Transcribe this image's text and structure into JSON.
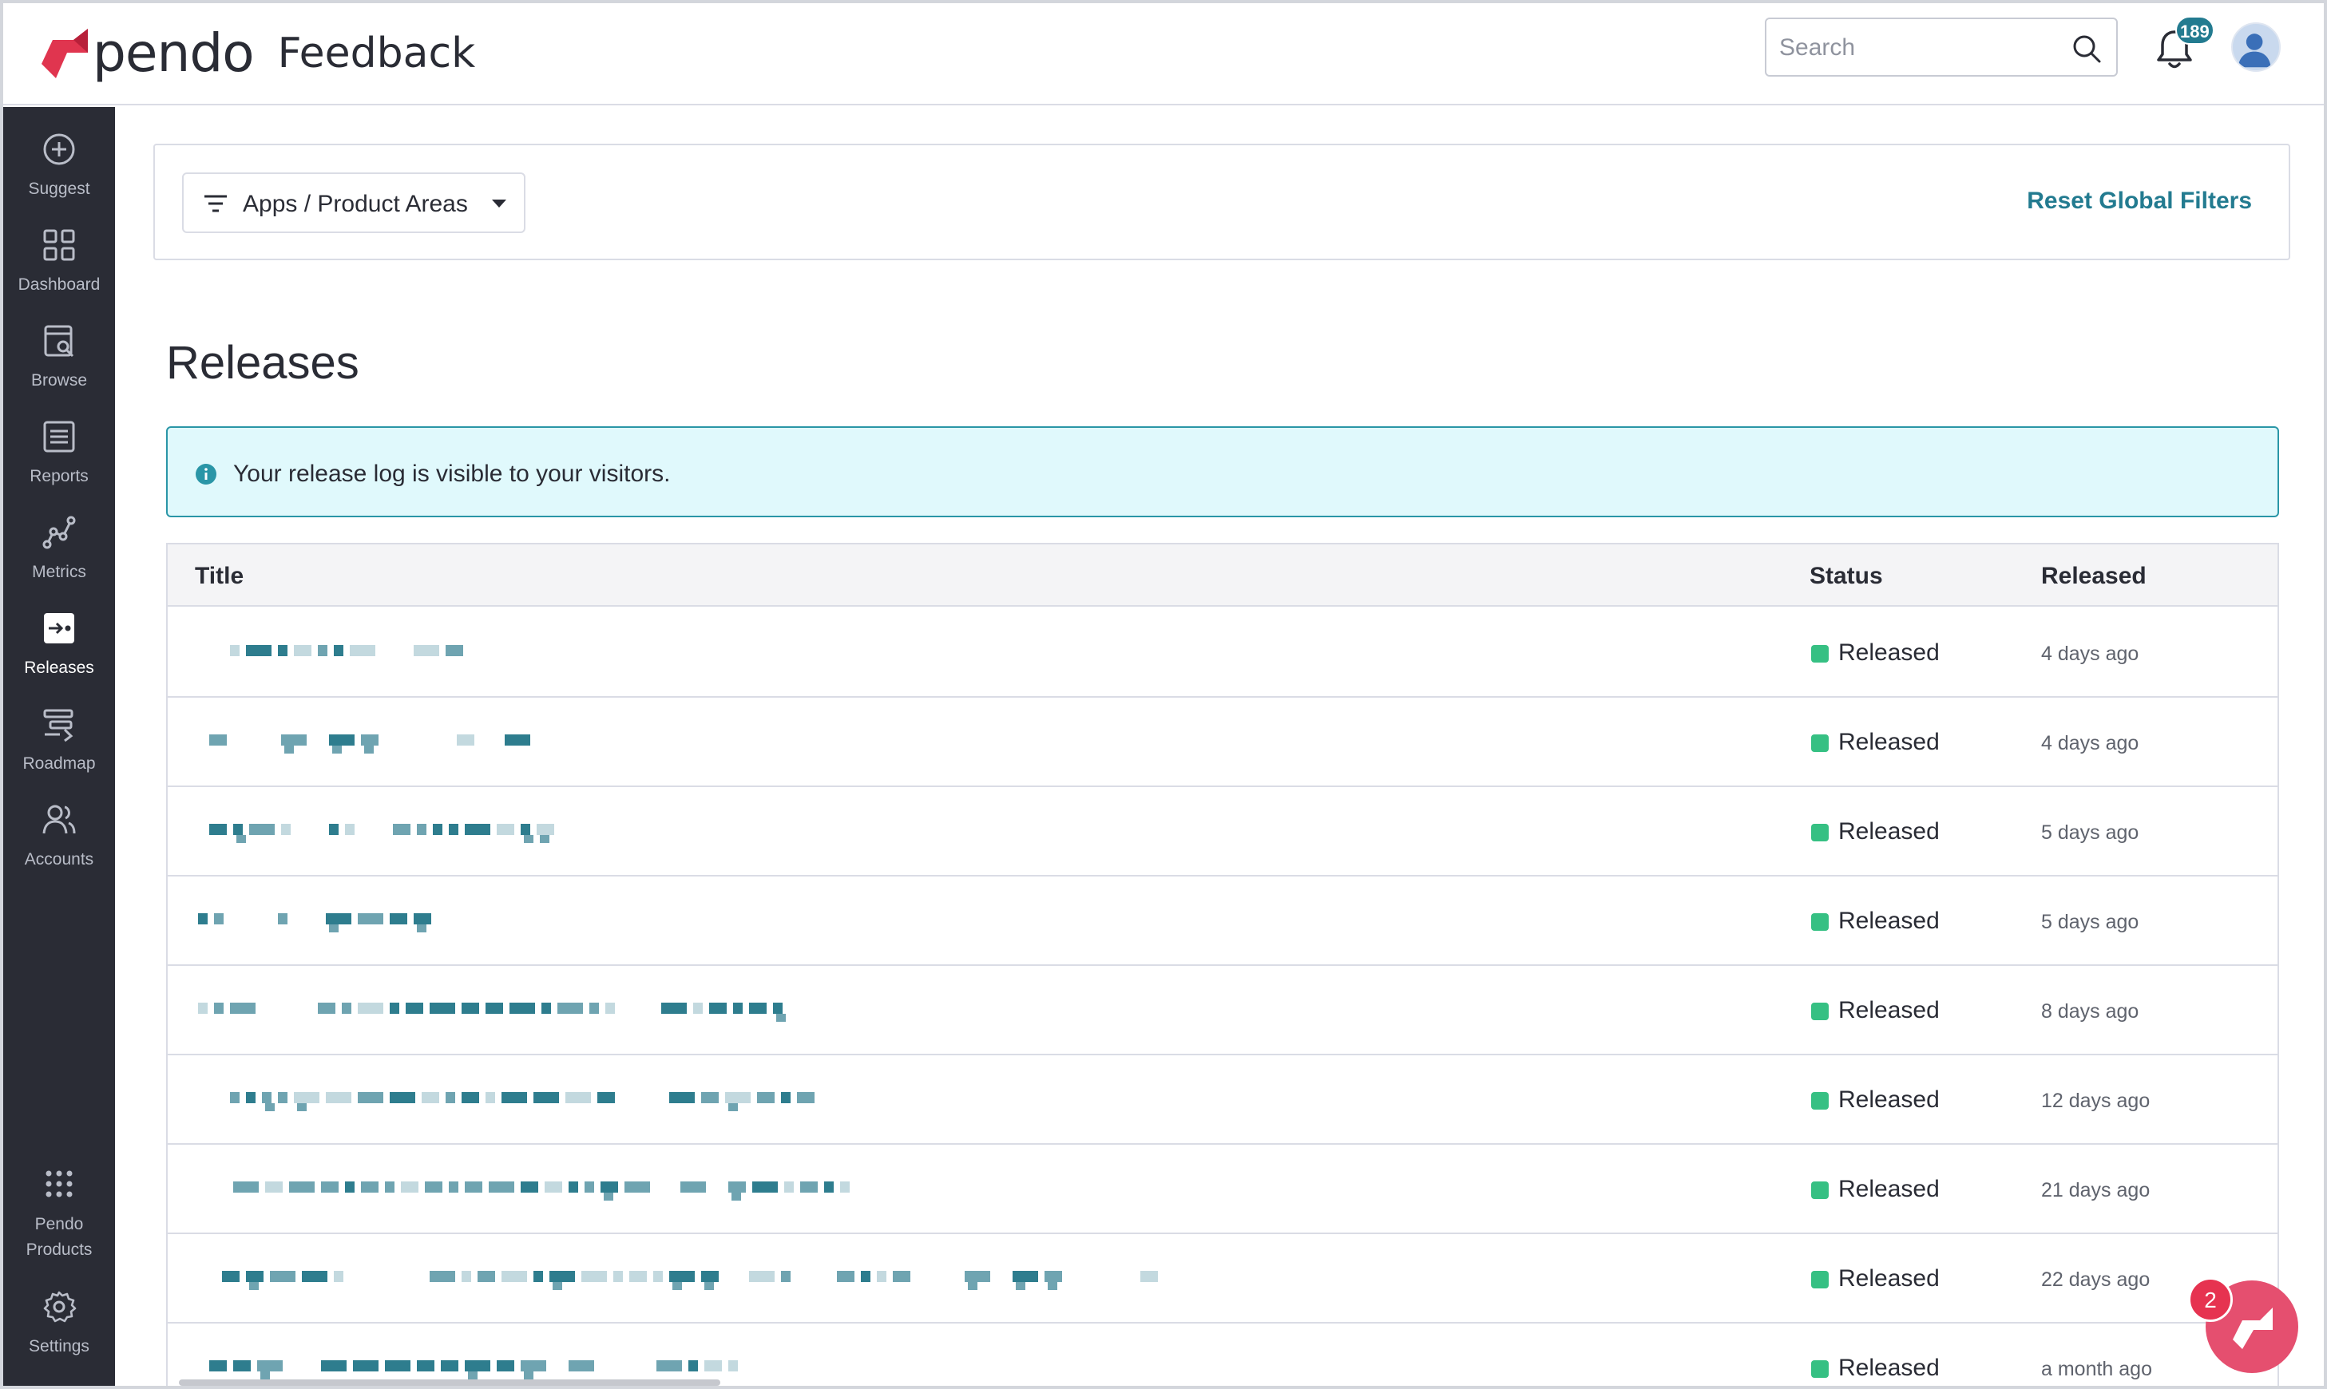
{
  "app": {
    "logo_text": "pendo",
    "product_name": "Feedback",
    "brand_color": "#e0354f"
  },
  "header": {
    "search_placeholder": "Search",
    "notifications_count": "189",
    "icons": [
      "search-icon",
      "bell-icon",
      "user-avatar-icon"
    ]
  },
  "sidebar": {
    "items": [
      {
        "label": "Suggest",
        "icon": "plus-circle-icon"
      },
      {
        "label": "Dashboard",
        "icon": "grid-icon"
      },
      {
        "label": "Browse",
        "icon": "browse-icon"
      },
      {
        "label": "Reports",
        "icon": "list-icon"
      },
      {
        "label": "Metrics",
        "icon": "metrics-icon"
      },
      {
        "label": "Releases",
        "icon": "releases-icon",
        "active": true
      },
      {
        "label": "Roadmap",
        "icon": "roadmap-icon"
      },
      {
        "label": "Accounts",
        "icon": "accounts-icon"
      }
    ],
    "bottom_items": [
      {
        "label_line1": "Pendo",
        "label_line2": "Products",
        "icon": "apps-grid-icon"
      },
      {
        "label": "Settings",
        "icon": "gear-icon"
      }
    ]
  },
  "filters": {
    "dropdown_label": "Apps / Product Areas",
    "reset_label": "Reset Global Filters"
  },
  "page": {
    "title": "Releases",
    "info_banner": "Your release log is visible to your visitors."
  },
  "table": {
    "columns": [
      "Title",
      "Status",
      "Released"
    ],
    "rows": [
      {
        "title": "[redacted]",
        "status": "Released",
        "released": "4 days ago"
      },
      {
        "title": "[redacted]",
        "status": "Released",
        "released": "4 days ago"
      },
      {
        "title": "[redacted]",
        "status": "Released",
        "released": "5 days ago"
      },
      {
        "title": "[redacted]",
        "status": "Released",
        "released": "5 days ago"
      },
      {
        "title": "[redacted]",
        "status": "Released",
        "released": "8 days ago"
      },
      {
        "title": "[redacted]",
        "status": "Released",
        "released": "12 days ago"
      },
      {
        "title": "[redacted]",
        "status": "Released",
        "released": "21 days ago"
      },
      {
        "title": "[redacted]",
        "status": "Released",
        "released": "22 days ago"
      },
      {
        "title": "[redacted]",
        "status": "Released",
        "released": "a month ago"
      }
    ],
    "status_color": "#36c083"
  },
  "resource_center": {
    "badge_count": "2",
    "color": "#e54f6f"
  }
}
